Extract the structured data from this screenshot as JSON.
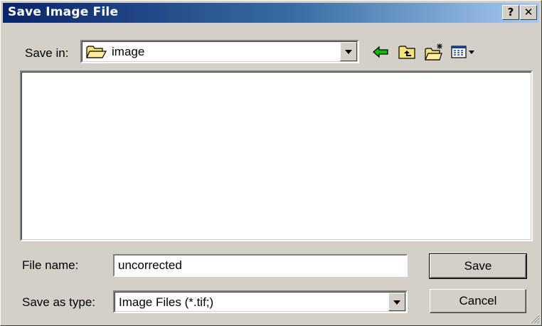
{
  "window": {
    "title": "Save Image File",
    "help_label": "?",
    "close_label": "✕"
  },
  "save_in": {
    "label": "Save in:",
    "folder": "image"
  },
  "toolbar": {
    "back_icon": "back-arrow-icon",
    "up_icon": "up-folder-icon",
    "new_folder_icon": "new-folder-icon",
    "view_icon": "view-menu-icon"
  },
  "file_name": {
    "label": "File name:",
    "value": "uncorrected"
  },
  "save_as_type": {
    "label": "Save as type:",
    "value": "Image Files (*.tif;)"
  },
  "buttons": {
    "save": "Save",
    "cancel": "Cancel"
  },
  "colors": {
    "title_start": "#0a246a",
    "title_end": "#a6caf0",
    "face": "#d4d0c8"
  }
}
